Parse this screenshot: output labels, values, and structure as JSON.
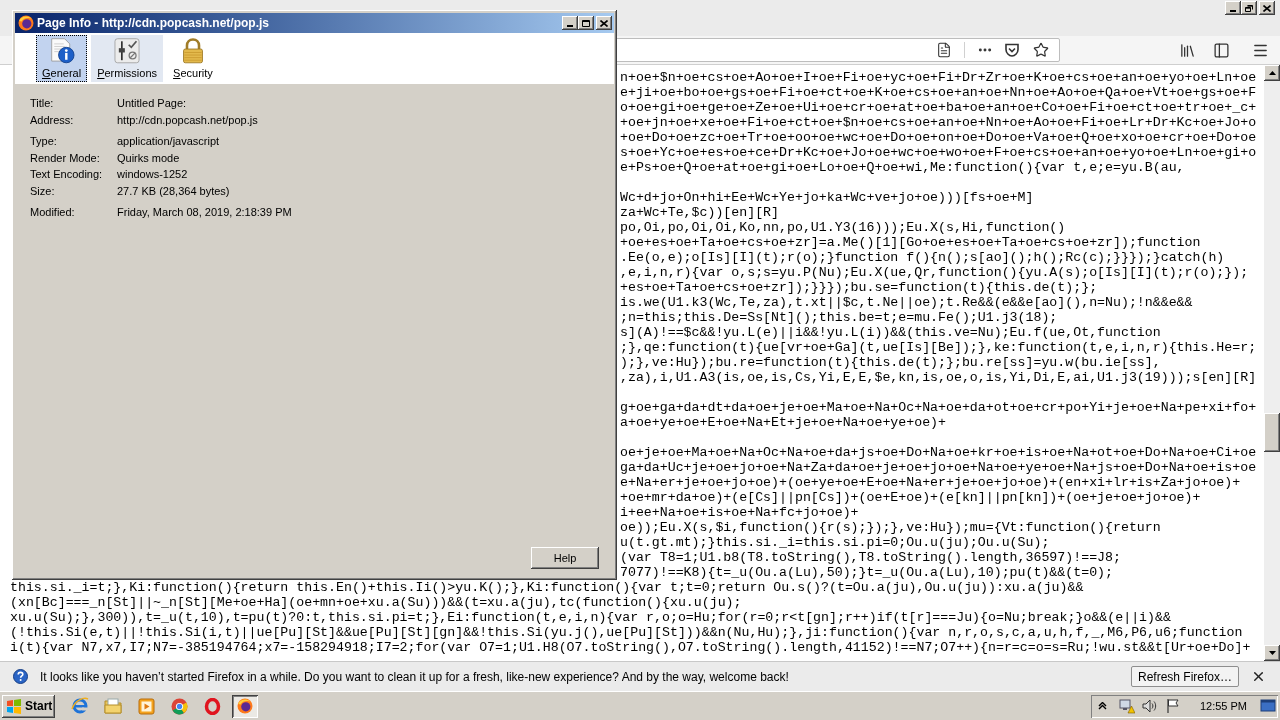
{
  "dialog": {
    "title": "Page Info - http://cdn.popcash.net/pop.js",
    "tabs": [
      {
        "label": "General",
        "selected": true,
        "hovered": false
      },
      {
        "label": "Permissions",
        "selected": false,
        "hovered": true
      },
      {
        "label": "Security",
        "selected": false,
        "hovered": false
      }
    ],
    "field_groups": [
      [
        {
          "label": "Title:",
          "value": "Untitled Page:"
        },
        {
          "label": "Address:",
          "value": "http://cdn.popcash.net/pop.js"
        }
      ],
      [
        {
          "label": "Type:",
          "value": "application/javascript"
        },
        {
          "label": "Render Mode:",
          "value": "Quirks mode"
        },
        {
          "label": "Text Encoding:",
          "value": "windows-1252"
        },
        {
          "label": "Size:",
          "value": "27.7 KB (28,364 bytes)"
        }
      ],
      [
        {
          "label": "Modified:",
          "value": "Friday, March 08, 2019, 2:18:39 PM"
        }
      ]
    ],
    "help_button": "Help"
  },
  "source_view": {
    "blocks_beside_dialog": [
      [
        "n+oe+$n+oe+cs+oe+Ao+oe+I+oe+Fi+oe+yc+oe+Fi+Dr+Zr+oe+K+oe+cs+oe+an+oe+yo+oe+Ln+oe",
        "e+ji+oe+bo+oe+gs+oe+Fi+oe+ct+oe+K+oe+cs+oe+an+oe+Nn+oe+Ao+oe+Qa+oe+Vt+oe+gs+oe+F",
        "o+oe+gi+oe+ge+oe+Ze+oe+Ui+oe+cr+oe+at+oe+ba+oe+an+oe+Co+oe+Fi+oe+ct+oe+tr+oe+_c+",
        "+oe+jn+oe+xe+oe+Fi+oe+ct+oe+$n+oe+cs+oe+an+oe+Nn+oe+Ao+oe+Fi+oe+Lr+Dr+Kc+oe+Jo+o",
        "+oe+Do+oe+zc+oe+Tr+oe+oo+oe+wc+oe+Do+oe+on+oe+Do+oe+Va+oe+Q+oe+xo+oe+cr+oe+Do+oe",
        "s+oe+Yc+oe+es+oe+ce+Dr+Kc+oe+Jo+oe+wc+oe+wo+oe+F+oe+cs+oe+an+oe+yo+oe+Ln+oe+gi+o",
        "e+Ps+oe+Q+oe+at+oe+gi+oe+Lo+oe+Q+oe+wi,Me:function(){var t,e;e=yu.B(au,"
      ],
      [
        "Wc+d+jo+On+hi+Ee+Wc+Ye+jo+ka+Wc+ve+jo+oe)))[fs+oe+M]",
        "za+Wc+Te,$c))[en][R]",
        "po,Oi,po,Oi,Oi,Ko,nn,po,U1.Y3(16)));Eu.X(s,Hi,function()",
        "+oe+es+oe+Ta+oe+cs+oe+zr]=a.Me()[1][Go+oe+es+oe+Ta+oe+cs+oe+zr]);function",
        ".Ee(o,e);o[Is][I](t);r(o);}function f(){n();s[ao]();h();Rc(c);}}});}catch(h)",
        ",e,i,n,r){var o,s;s=yu.P(Nu);Eu.X(ue,Qr,function(){yu.A(s);o[Is][I](t);r(o);});",
        "+es+oe+Ta+oe+cs+oe+zr]);}}});bu.se=function(t){this.de(t);};",
        "is.we(U1.k3(Wc,Te,za),t.xt||$c,t.Ne||oe);t.Re&&(e&&e[ao](),n=Nu);!n&&e&&",
        ";n=this;this.De=Ss[Nt]();this.be=t;e=mu.Fe();U1.j3(18);",
        "s](A)!==$c&&!yu.L(e)||i&&!yu.L(i))&&(this.ve=Nu);Eu.f(ue,Ot,function",
        ";},qe:function(t){ue[vr+oe+Ga](t,ue[Is][Be]);},ke:function(t,e,i,n,r){this.He=r;",
        ");},ve:Hu});bu.re=function(t){this.de(t);};bu.re[ss]=yu.w(bu.ie[ss],",
        ",za),i,U1.A3(is,oe,is,Cs,Yi,E,E,$e,kn,is,oe,o,is,Yi,Di,E,ai,U1.j3(19)));s[en][R]"
      ],
      [
        "g+oe+ga+da+dt+da+oe+je+oe+Ma+oe+Na+Oc+Na+oe+da+ot+oe+cr+po+Yi+je+oe+Na+pe+xi+fo+",
        "a+oe+ye+oe+E+oe+Na+Et+je+oe+Na+oe+ye+oe)+"
      ],
      [
        "oe+je+oe+Ma+oe+Na+Oc+Na+oe+da+js+oe+Do+Na+oe+kr+oe+is+oe+Na+ot+oe+Do+Na+oe+Ci+oe",
        "ga+da+Uc+je+oe+jo+oe+Na+Za+da+oe+je+oe+jo+oe+Na+oe+ye+oe+Na+js+oe+Do+Na+oe+is+oe",
        "e+Na+er+je+oe+jo+oe)+(oe+ye+oe+E+oe+Na+er+je+oe+jo+oe)+(en+xi+lr+is+Za+jo+oe)+",
        "+oe+mr+da+oe)+(e[Cs]||pn[Cs])+(oe+E+oe)+(e[kn]||pn[kn])+(oe+je+oe+jo+oe)+",
        "i+ee+Na+oe+is+oe+Na+fc+jo+oe)+",
        "oe));Eu.X(s,$i,function(){r(s);});},ve:Hu});mu={Vt:function(){return",
        "u(t.gt.mt);}this.si._i=this.si.pi=0;Ou.u(ju);Ou.u(Su);",
        "(var T8=1;U1.b8(T8.toString(),T8.toString().length,36597)!==J8;",
        "7077)!==K8){t=_u(Ou.a(Lu),50);}t=_u(Ou.a(Lu),10);pu(t)&&(t=0);"
      ]
    ],
    "lines_below_dialog": [
      "this.si._i=t;},Ki:function(){return this.En()+this.Ii()>yu.K();},Ki:function(){var t;t=0;return Ou.s()?(t=Ou.a(ju),Ou.u(ju)):xu.a(ju)&&",
      "(xn[Bc]===_n[St]||~_n[St][Me+oe+Ha](oe+mn+oe+xu.a(Su)))&&(t=xu.a(ju),tc(function(){xu.u(ju);",
      "xu.u(Su);},300)),t=_u(t,10),t=pu(t)?0:t,this.si.pi=t;},Ei:function(t,e,i,n){var r,o;o=Hu;for(r=0;r<t[gn];r++)if(t[r]===Ju){o=Nu;break;}o&&(e||i)&&",
      "(!this.Si(e,t)||!this.Si(i,t)||ue[Pu][St]&&ue[Pu][St][gn]&&!this.Si(yu.j(),ue[Pu][St]))&&n(Nu,Hu);},ji:function(){var n,r,o,s,c,a,u,h,f,_,M6,P6,u6;function",
      "i(t){var N7,x7,I7;N7=-385194764;x7=-158294918;I7=2;for(var O7=1;U1.H8(O7.toString(),O7.toString().length,41152)!==N7;O7++){n=r=c=o=s=Ru;!wu.st&&t[Ur+oe+Do]+"
    ]
  },
  "notification_bar": {
    "message": "It looks like you haven’t started Firefox in a while. Do you want to clean it up for a fresh, like-new experience? And by the way, welcome back!",
    "button": "Refresh Firefox…"
  },
  "taskbar": {
    "start_button": "Start",
    "apps": [
      {
        "kind": "letter-e",
        "selected": false
      },
      {
        "kind": "folder",
        "selected": false
      },
      {
        "kind": "play",
        "selected": false
      },
      {
        "kind": "pinwheel",
        "selected": false
      },
      {
        "kind": "ring",
        "selected": false
      },
      {
        "kind": "fox-globe",
        "selected": true
      }
    ],
    "clock": "12:55 PM"
  }
}
